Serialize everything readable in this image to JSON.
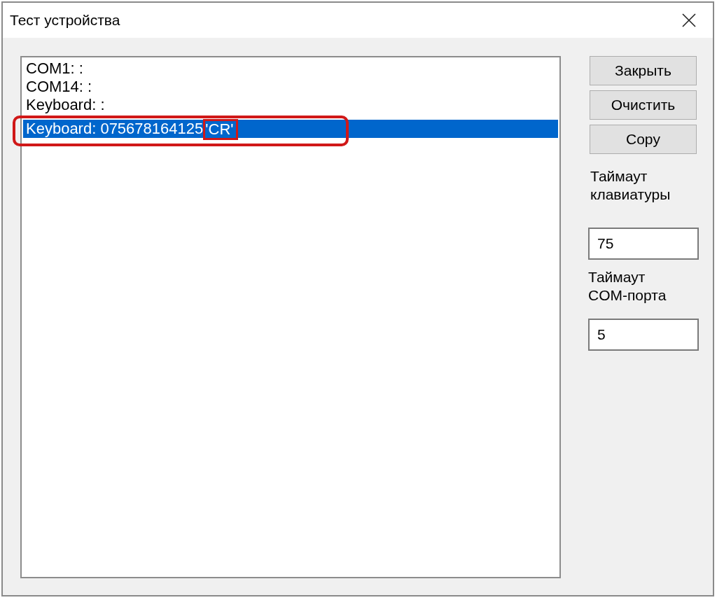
{
  "window": {
    "title": "Тест устройства"
  },
  "log_list": {
    "items": [
      {
        "text": "COM1: :",
        "selected": false,
        "circled": false
      },
      {
        "text": "COM14: :",
        "selected": false,
        "circled": false
      },
      {
        "text": "Keyboard: :",
        "selected": false,
        "circled": false
      },
      {
        "text": "Keyboard: 075678164125",
        "marked_text": "'CR'",
        "selected": true,
        "circled": true
      }
    ]
  },
  "buttons": [
    "Закрыть",
    "Очистить",
    "Copy"
  ],
  "settings": [
    {
      "label": "Таймаут клавиатуры",
      "value": "75"
    },
    {
      "label": "Таймаут COM-порта",
      "value": "5"
    }
  ]
}
